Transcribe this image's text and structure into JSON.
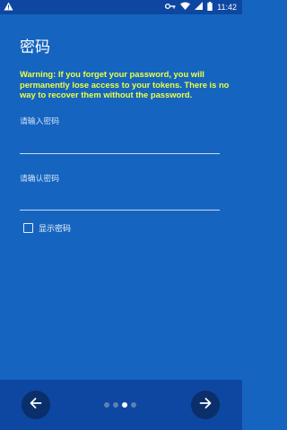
{
  "status_bar": {
    "time": "11:42",
    "icons": [
      "warning-icon",
      "key-icon",
      "wifi-icon",
      "signal-icon",
      "battery-icon"
    ]
  },
  "page": {
    "title": "密码",
    "warning": "Warning: If you forget your password, you will permanently lose access to your tokens. There is no way to recover them without the password."
  },
  "form": {
    "password_label": "请输入密码",
    "password_value": "",
    "confirm_label": "请确认密码",
    "confirm_value": "",
    "show_password_label": "显示密码",
    "show_password_checked": false
  },
  "nav": {
    "prev_icon": "arrow-left-icon",
    "next_icon": "arrow-right-icon",
    "page_count": 4,
    "active_page": 3
  },
  "colors": {
    "background": "#1565c0",
    "status_bar": "#0d47a1",
    "bottom_bar": "#0d47a1",
    "warning_text": "#eeff41",
    "button": "#0a2f6b"
  }
}
